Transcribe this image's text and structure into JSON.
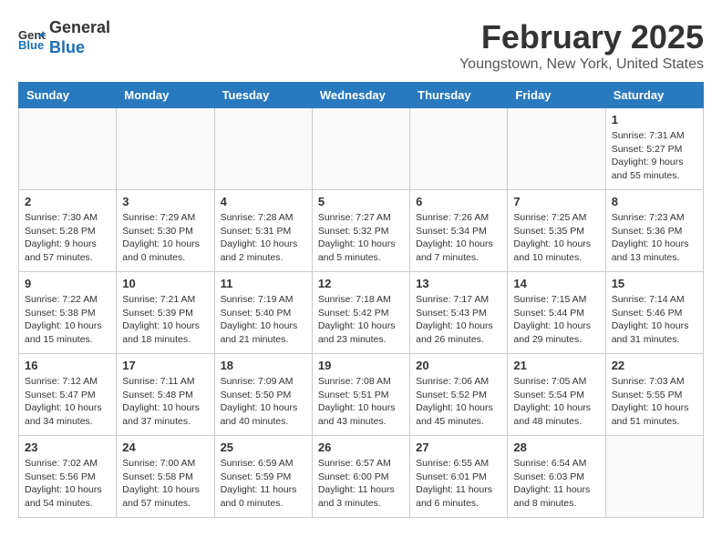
{
  "header": {
    "logo_line1": "General",
    "logo_line2": "Blue",
    "title": "February 2025",
    "subtitle": "Youngstown, New York, United States"
  },
  "weekdays": [
    "Sunday",
    "Monday",
    "Tuesday",
    "Wednesday",
    "Thursday",
    "Friday",
    "Saturday"
  ],
  "weeks": [
    [
      {
        "day": "",
        "info": ""
      },
      {
        "day": "",
        "info": ""
      },
      {
        "day": "",
        "info": ""
      },
      {
        "day": "",
        "info": ""
      },
      {
        "day": "",
        "info": ""
      },
      {
        "day": "",
        "info": ""
      },
      {
        "day": "1",
        "info": "Sunrise: 7:31 AM\nSunset: 5:27 PM\nDaylight: 9 hours\nand 55 minutes."
      }
    ],
    [
      {
        "day": "2",
        "info": "Sunrise: 7:30 AM\nSunset: 5:28 PM\nDaylight: 9 hours\nand 57 minutes."
      },
      {
        "day": "3",
        "info": "Sunrise: 7:29 AM\nSunset: 5:30 PM\nDaylight: 10 hours\nand 0 minutes."
      },
      {
        "day": "4",
        "info": "Sunrise: 7:28 AM\nSunset: 5:31 PM\nDaylight: 10 hours\nand 2 minutes."
      },
      {
        "day": "5",
        "info": "Sunrise: 7:27 AM\nSunset: 5:32 PM\nDaylight: 10 hours\nand 5 minutes."
      },
      {
        "day": "6",
        "info": "Sunrise: 7:26 AM\nSunset: 5:34 PM\nDaylight: 10 hours\nand 7 minutes."
      },
      {
        "day": "7",
        "info": "Sunrise: 7:25 AM\nSunset: 5:35 PM\nDaylight: 10 hours\nand 10 minutes."
      },
      {
        "day": "8",
        "info": "Sunrise: 7:23 AM\nSunset: 5:36 PM\nDaylight: 10 hours\nand 13 minutes."
      }
    ],
    [
      {
        "day": "9",
        "info": "Sunrise: 7:22 AM\nSunset: 5:38 PM\nDaylight: 10 hours\nand 15 minutes."
      },
      {
        "day": "10",
        "info": "Sunrise: 7:21 AM\nSunset: 5:39 PM\nDaylight: 10 hours\nand 18 minutes."
      },
      {
        "day": "11",
        "info": "Sunrise: 7:19 AM\nSunset: 5:40 PM\nDaylight: 10 hours\nand 21 minutes."
      },
      {
        "day": "12",
        "info": "Sunrise: 7:18 AM\nSunset: 5:42 PM\nDaylight: 10 hours\nand 23 minutes."
      },
      {
        "day": "13",
        "info": "Sunrise: 7:17 AM\nSunset: 5:43 PM\nDaylight: 10 hours\nand 26 minutes."
      },
      {
        "day": "14",
        "info": "Sunrise: 7:15 AM\nSunset: 5:44 PM\nDaylight: 10 hours\nand 29 minutes."
      },
      {
        "day": "15",
        "info": "Sunrise: 7:14 AM\nSunset: 5:46 PM\nDaylight: 10 hours\nand 31 minutes."
      }
    ],
    [
      {
        "day": "16",
        "info": "Sunrise: 7:12 AM\nSunset: 5:47 PM\nDaylight: 10 hours\nand 34 minutes."
      },
      {
        "day": "17",
        "info": "Sunrise: 7:11 AM\nSunset: 5:48 PM\nDaylight: 10 hours\nand 37 minutes."
      },
      {
        "day": "18",
        "info": "Sunrise: 7:09 AM\nSunset: 5:50 PM\nDaylight: 10 hours\nand 40 minutes."
      },
      {
        "day": "19",
        "info": "Sunrise: 7:08 AM\nSunset: 5:51 PM\nDaylight: 10 hours\nand 43 minutes."
      },
      {
        "day": "20",
        "info": "Sunrise: 7:06 AM\nSunset: 5:52 PM\nDaylight: 10 hours\nand 45 minutes."
      },
      {
        "day": "21",
        "info": "Sunrise: 7:05 AM\nSunset: 5:54 PM\nDaylight: 10 hours\nand 48 minutes."
      },
      {
        "day": "22",
        "info": "Sunrise: 7:03 AM\nSunset: 5:55 PM\nDaylight: 10 hours\nand 51 minutes."
      }
    ],
    [
      {
        "day": "23",
        "info": "Sunrise: 7:02 AM\nSunset: 5:56 PM\nDaylight: 10 hours\nand 54 minutes."
      },
      {
        "day": "24",
        "info": "Sunrise: 7:00 AM\nSunset: 5:58 PM\nDaylight: 10 hours\nand 57 minutes."
      },
      {
        "day": "25",
        "info": "Sunrise: 6:59 AM\nSunset: 5:59 PM\nDaylight: 11 hours\nand 0 minutes."
      },
      {
        "day": "26",
        "info": "Sunrise: 6:57 AM\nSunset: 6:00 PM\nDaylight: 11 hours\nand 3 minutes."
      },
      {
        "day": "27",
        "info": "Sunrise: 6:55 AM\nSunset: 6:01 PM\nDaylight: 11 hours\nand 6 minutes."
      },
      {
        "day": "28",
        "info": "Sunrise: 6:54 AM\nSunset: 6:03 PM\nDaylight: 11 hours\nand 8 minutes."
      },
      {
        "day": "",
        "info": ""
      }
    ]
  ]
}
